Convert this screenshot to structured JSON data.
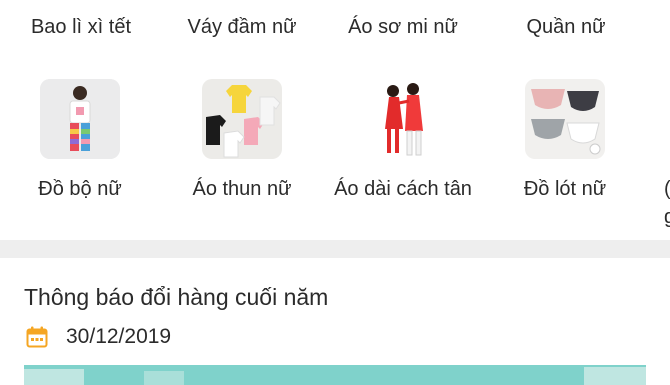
{
  "categories_row1": [
    {
      "label": "Bao lì xì tết"
    },
    {
      "label": "Váy đầm nữ"
    },
    {
      "label": "Áo sơ mi nữ"
    },
    {
      "label": "Quần nữ"
    }
  ],
  "categories_row2": [
    {
      "label": "Đồ bộ nữ",
      "icon": "women-pajama-set-thumbnail"
    },
    {
      "label": "Áo thun nữ",
      "icon": "women-tshirts-thumbnail"
    },
    {
      "label": "Áo dài cách tân",
      "icon": "modern-ao-dai-thumbnail"
    },
    {
      "label": "Đồ lót nữ",
      "icon": "women-underwear-thumbnail"
    }
  ],
  "partial_category": {
    "label_line1": "(",
    "label_line2": "g"
  },
  "post": {
    "title": "Thông báo đổi hàng cuối năm",
    "date": "30/12/2019",
    "date_icon": "calendar-icon"
  },
  "colors": {
    "accent_orange": "#f5a623",
    "divider": "#eeeeee",
    "banner": "#7fd2cb"
  }
}
